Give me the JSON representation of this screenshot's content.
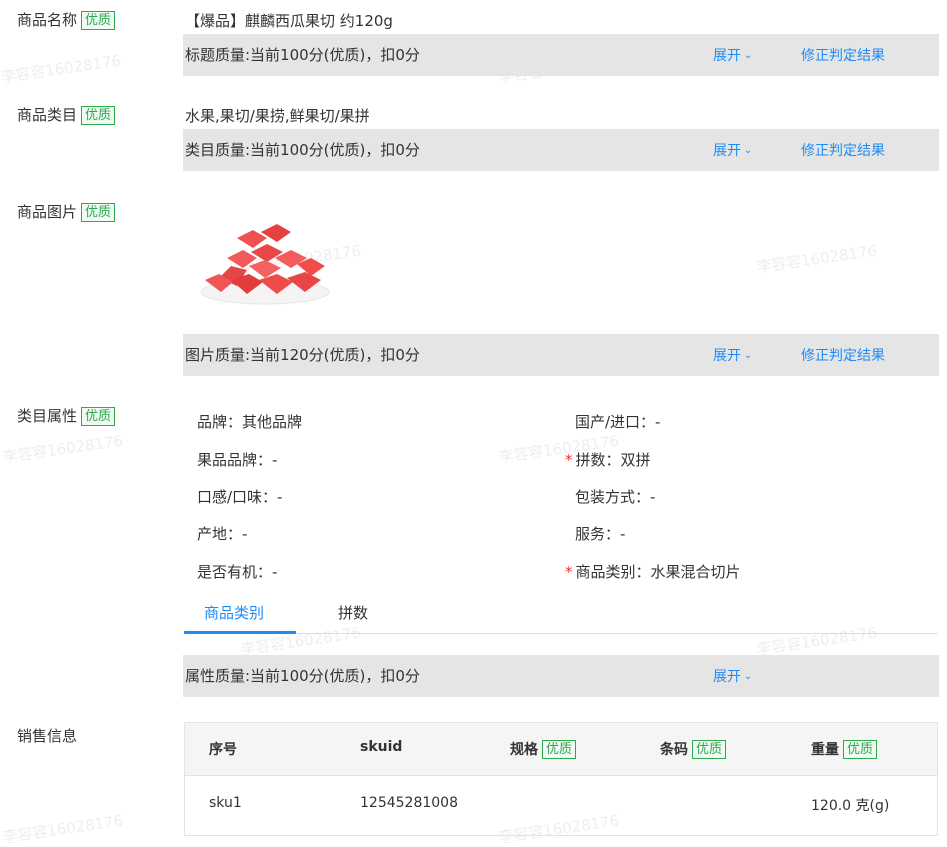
{
  "name_row": {
    "label": "商品名称",
    "badge": "优质",
    "value": "【爆品】麒麟西瓜果切 约120g"
  },
  "title_bar": {
    "quality": "标题质量:当前100分(优质)，扣0分",
    "expand": "展开",
    "fix": "修正判定结果"
  },
  "category_row": {
    "label": "商品类目",
    "badge": "优质",
    "value": "水果,果切/果捞,鲜果切/果拼"
  },
  "category_bar": {
    "quality": "类目质量:当前100分(优质)，扣0分",
    "expand": "展开",
    "fix": "修正判定结果"
  },
  "image_row": {
    "label": "商品图片",
    "badge": "优质"
  },
  "image_bar": {
    "quality": "图片质量:当前120分(优质)，扣0分",
    "expand": "展开",
    "fix": "修正判定结果"
  },
  "attr_row": {
    "label": "类目属性",
    "badge": "优质"
  },
  "attributes": {
    "left": [
      {
        "text": "品牌：其他品牌"
      },
      {
        "text": "果品品牌：-"
      },
      {
        "text": "口感/口味：-"
      },
      {
        "text": "产地：-"
      },
      {
        "text": "是否有机：-"
      }
    ],
    "right": [
      {
        "text": "国产/进口：-",
        "required": false
      },
      {
        "text": "拼数：双拼",
        "required": true
      },
      {
        "text": "包装方式：-",
        "required": false
      },
      {
        "text": "服务：-",
        "required": false
      },
      {
        "text": "商品类别：水果混合切片",
        "required": true
      }
    ]
  },
  "attr_tabs": [
    {
      "label": "商品类别",
      "active": true
    },
    {
      "label": "拼数",
      "active": false
    }
  ],
  "attr_bar": {
    "quality": "属性质量:当前100分(优质)，扣0分",
    "expand": "展开"
  },
  "sales": {
    "label": "销售信息",
    "headers": {
      "index": "序号",
      "skuid": "skuid",
      "spec": "规格",
      "spec_badge": "优质",
      "barcode": "条码",
      "barcode_badge": "优质",
      "weight": "重量",
      "weight_badge": "优质"
    },
    "rows": [
      {
        "index": "sku1",
        "skuid": "12545281008",
        "spec": "",
        "barcode": "",
        "weight": "120.0 克(g)"
      }
    ]
  },
  "watermark": "李容容16028176",
  "colors": {
    "accent": "#1d8cf8",
    "good": "#2fa84f",
    "required": "#e5372f",
    "bar_bg": "#e5e5e5"
  },
  "icons": {
    "chevron": "chevron-down-icon"
  }
}
